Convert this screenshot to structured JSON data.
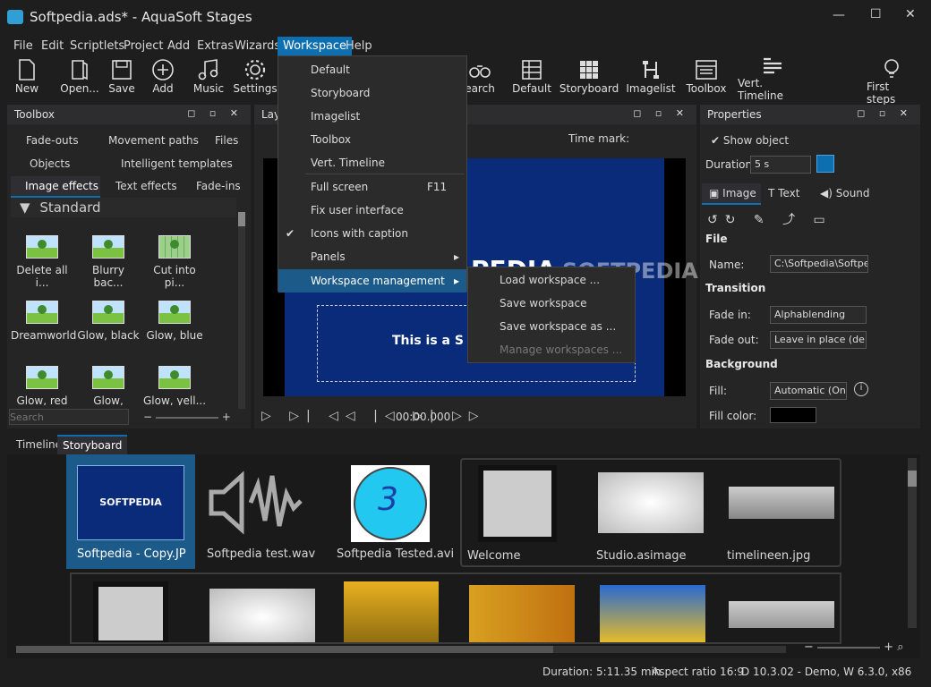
{
  "window": {
    "title": "Softpedia.ads* - AquaSoft Stages",
    "min": "—",
    "max": "☐",
    "close": "✕"
  },
  "menubar": [
    "File",
    "Edit",
    "Scriptlets",
    "Project",
    "Add",
    "Extras",
    "Wizards",
    "Workspace",
    "Help"
  ],
  "toolbar": {
    "new": "New",
    "open": "Open...",
    "save": "Save",
    "add": "Add",
    "music": "Music",
    "settings": "Settings",
    "search": "earch",
    "default": "Default",
    "storyboard": "Storyboard",
    "imagelist": "Imagelist",
    "toolbox": "Toolbox",
    "vert_timeline": "Vert. Timeline",
    "first_steps": "First steps"
  },
  "workspace_menu": {
    "items": [
      "Default",
      "Storyboard",
      "Imagelist",
      "Toolbox",
      "Vert. Timeline",
      "Full screen",
      "Fix user interface",
      "Icons with caption",
      "Panels",
      "Workspace management"
    ],
    "shortcut_full_screen": "F11"
  },
  "workspace_submenu": [
    "Load workspace ...",
    "Save workspace",
    "Save workspace as ...",
    "Manage workspaces ..."
  ],
  "toolbox": {
    "title": "Toolbox",
    "tabs_row1": [
      "Fade-outs",
      "Movement paths",
      "Files"
    ],
    "tabs_row2": [
      "Objects",
      "Intelligent templates"
    ],
    "tabs_row3": [
      "Image effects",
      "Text effects",
      "Fade-ins"
    ],
    "group": "Standard",
    "effects": [
      "Delete all i...",
      "Blurry bac...",
      "Cut into pi...",
      "Dreamworld",
      "Glow, black",
      "Glow, blue",
      "Glow, red",
      "Glow, white",
      "Glow, yell..."
    ],
    "search_placeholder": "Search"
  },
  "layout": {
    "title_fragment": "Lay",
    "time_mark": "Time mark:",
    "timecode": "00:00.000",
    "banner_text": "This is a S",
    "logo_text": "PEDIA",
    "watermark": "SOFTPEDIA"
  },
  "properties": {
    "title": "Properties",
    "show_object": "Show object",
    "duration_label": "Duration:",
    "duration_value": "5 s",
    "tabs": [
      "Image",
      "Text",
      "Sound"
    ],
    "file_section": "File",
    "name_label": "Name:",
    "name_value": "C:\\Softpedia\\Softpedi",
    "transition_section": "Transition",
    "fade_in_label": "Fade in:",
    "fade_in_value": "Alphablending",
    "fade_out_label": "Fade out:",
    "fade_out_value": "Leave in place (de",
    "background_section": "Background",
    "fill_label": "Fill:",
    "fill_value": "Automatic (On",
    "fill_color_label": "Fill color:"
  },
  "bottom_tabs": [
    "Timeline",
    "Storyboard"
  ],
  "storyboard": {
    "items": [
      "Softpedia - Copy.JP",
      "Softpedia test.wav",
      "Softpedia Tested.avi",
      "Welcome",
      "Studio.asimage",
      "timelineen.jpg"
    ],
    "first_thumb_text": "SOFTPEDIA",
    "clock_digit": "3"
  },
  "status": {
    "duration": "Duration: 5:11.35 min",
    "aspect": "Aspect ratio 16:9",
    "version": "D 10.3.02 - Demo, W 6.3.0, x86"
  },
  "colors": {
    "accent": "#0e6fb0",
    "menu_bg": "#2b2b2b",
    "selected_item": "#1c5a8a",
    "canvas_blue": "#0a2a7a"
  }
}
